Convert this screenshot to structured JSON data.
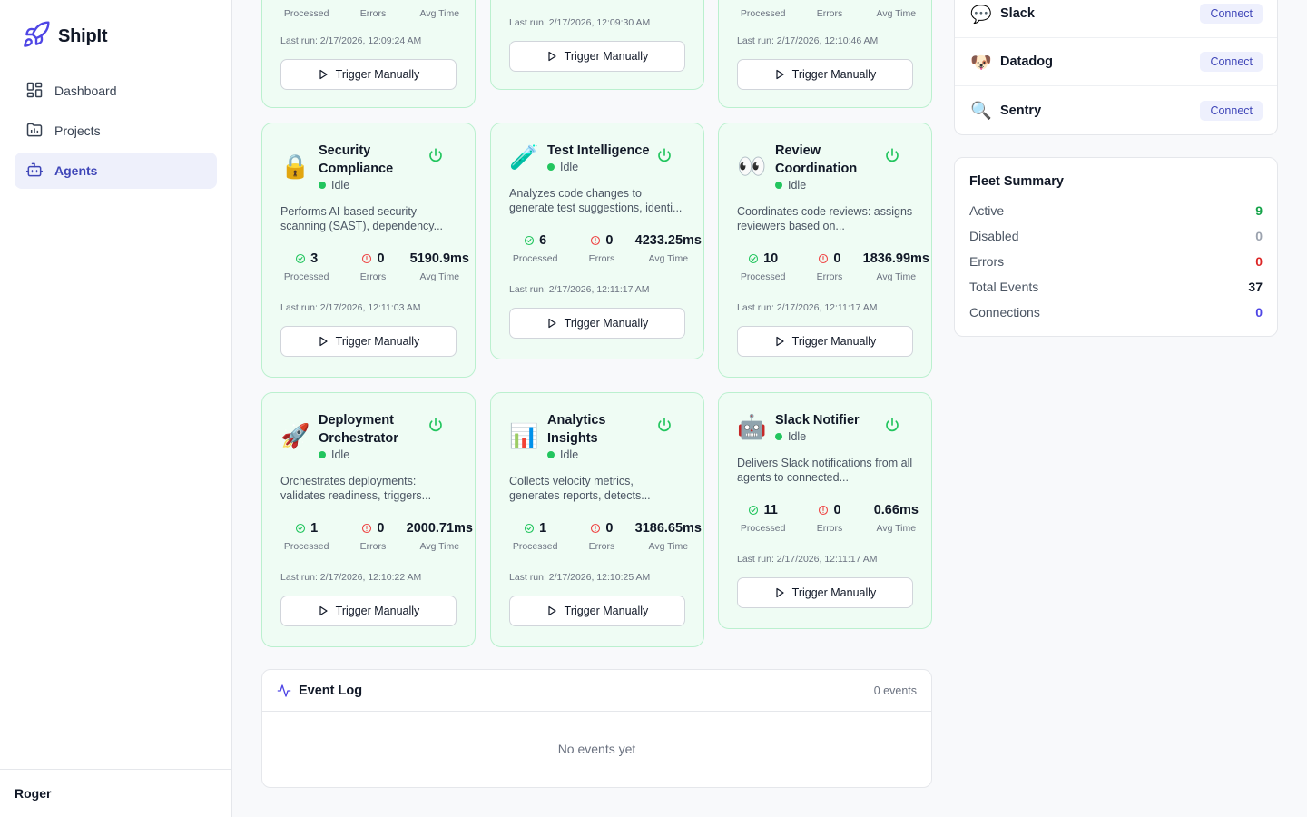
{
  "brand": {
    "name": "ShipIt"
  },
  "nav": [
    {
      "label": "Dashboard",
      "icon": "dashboard-icon",
      "active": false
    },
    {
      "label": "Projects",
      "icon": "projects-icon",
      "active": false
    },
    {
      "label": "Agents",
      "icon": "agents-icon",
      "active": true
    }
  ],
  "user": {
    "name": "Roger"
  },
  "labels": {
    "processed": "Processed",
    "errors": "Errors",
    "avg_time": "Avg Time",
    "trigger": "Trigger Manually"
  },
  "top_cards": [
    {
      "lastrun": "Last run: 2/17/2026, 12:09:24 AM"
    },
    {
      "lastrun": "Last run: 2/17/2026, 12:09:30 AM"
    },
    {
      "lastrun": "Last run: 2/17/2026, 12:10:46 AM"
    }
  ],
  "agents": [
    {
      "emoji": "🔒",
      "title": "Security Compliance",
      "status": "Idle",
      "desc": "Performs AI-based security scanning (SAST), dependency...",
      "processed": "3",
      "errors": "0",
      "avg_time": "5190.9ms",
      "lastrun": "Last run: 2/17/2026, 12:11:03 AM"
    },
    {
      "emoji": "🧪",
      "title": "Test Intelligence",
      "status": "Idle",
      "desc": "Analyzes code changes to generate test suggestions, identi...",
      "processed": "6",
      "errors": "0",
      "avg_time": "4233.25ms",
      "lastrun": "Last run: 2/17/2026, 12:11:17 AM"
    },
    {
      "emoji": "👀",
      "title": "Review Coordination",
      "status": "Idle",
      "desc": "Coordinates code reviews: assigns reviewers based on...",
      "processed": "10",
      "errors": "0",
      "avg_time": "1836.99ms",
      "lastrun": "Last run: 2/17/2026, 12:11:17 AM"
    },
    {
      "emoji": "🚀",
      "title": "Deployment Orchestrator",
      "status": "Idle",
      "desc": "Orchestrates deployments: validates readiness, triggers...",
      "processed": "1",
      "errors": "0",
      "avg_time": "2000.71ms",
      "lastrun": "Last run: 2/17/2026, 12:10:22 AM"
    },
    {
      "emoji": "📊",
      "title": "Analytics Insights",
      "status": "Idle",
      "desc": "Collects velocity metrics, generates reports, detects...",
      "processed": "1",
      "errors": "0",
      "avg_time": "3186.65ms",
      "lastrun": "Last run: 2/17/2026, 12:10:25 AM"
    },
    {
      "emoji": "🤖",
      "title": "Slack Notifier",
      "status": "Idle",
      "desc": "Delivers Slack notifications from all agents to connected...",
      "processed": "11",
      "errors": "0",
      "avg_time": "0.66ms",
      "lastrun": "Last run: 2/17/2026, 12:11:17 AM"
    }
  ],
  "event_log": {
    "title": "Event Log",
    "count": "0 events",
    "empty": "No events yet"
  },
  "integrations": [
    {
      "icon": "💬",
      "name": "Slack",
      "action": "Connect"
    },
    {
      "icon": "🐶",
      "name": "Datadog",
      "action": "Connect"
    },
    {
      "icon": "🔍",
      "name": "Sentry",
      "action": "Connect"
    }
  ],
  "fleet": {
    "title": "Fleet Summary",
    "rows": [
      {
        "label": "Active",
        "value": "9",
        "color": "#16a34a"
      },
      {
        "label": "Disabled",
        "value": "0",
        "color": "#9ca3af"
      },
      {
        "label": "Errors",
        "value": "0",
        "color": "#dc2626"
      },
      {
        "label": "Total Events",
        "value": "37",
        "color": "#111827"
      },
      {
        "label": "Connections",
        "value": "0",
        "color": "#4f46e5"
      }
    ]
  },
  "colors": {
    "accent": "#3f46b8",
    "success": "#22c55e",
    "error": "#ef4444",
    "card_bg": "#effcf4",
    "card_border": "#bbf0cf"
  }
}
